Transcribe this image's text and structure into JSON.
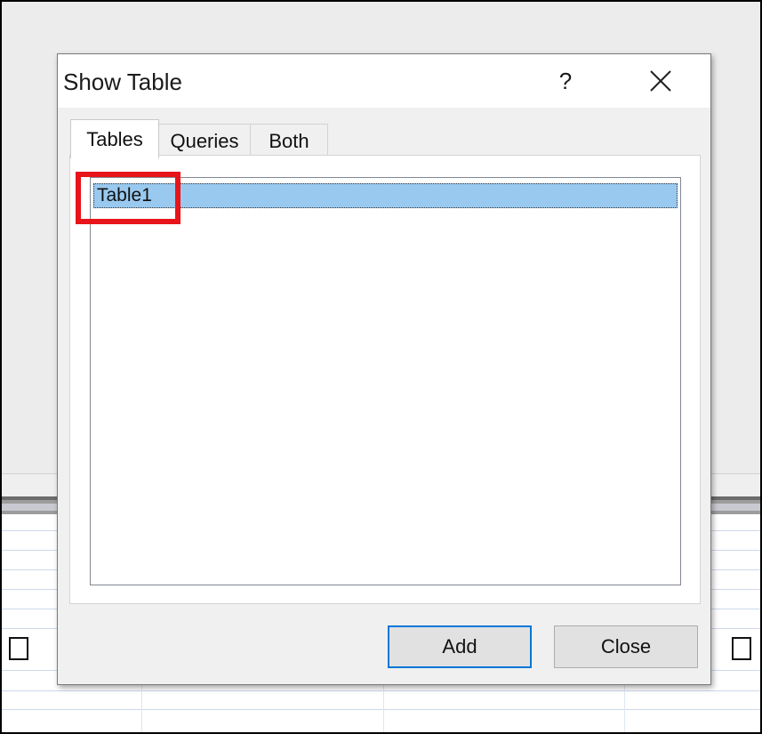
{
  "dialog": {
    "title": "Show Table",
    "help_label": "?",
    "tabs": [
      {
        "label": "Tables",
        "active": true
      },
      {
        "label": "Queries",
        "active": false
      },
      {
        "label": "Both",
        "active": false
      }
    ],
    "list_items": [
      "Table1"
    ],
    "selected_item": "Table1",
    "buttons": {
      "add": "Add",
      "close": "Close"
    }
  },
  "colors": {
    "selection": "#99c9ef",
    "highlight_box": "#e8141a",
    "default_button_border": "#0078d7"
  },
  "icons": {
    "close": "close-x-icon",
    "help": "question-mark"
  }
}
